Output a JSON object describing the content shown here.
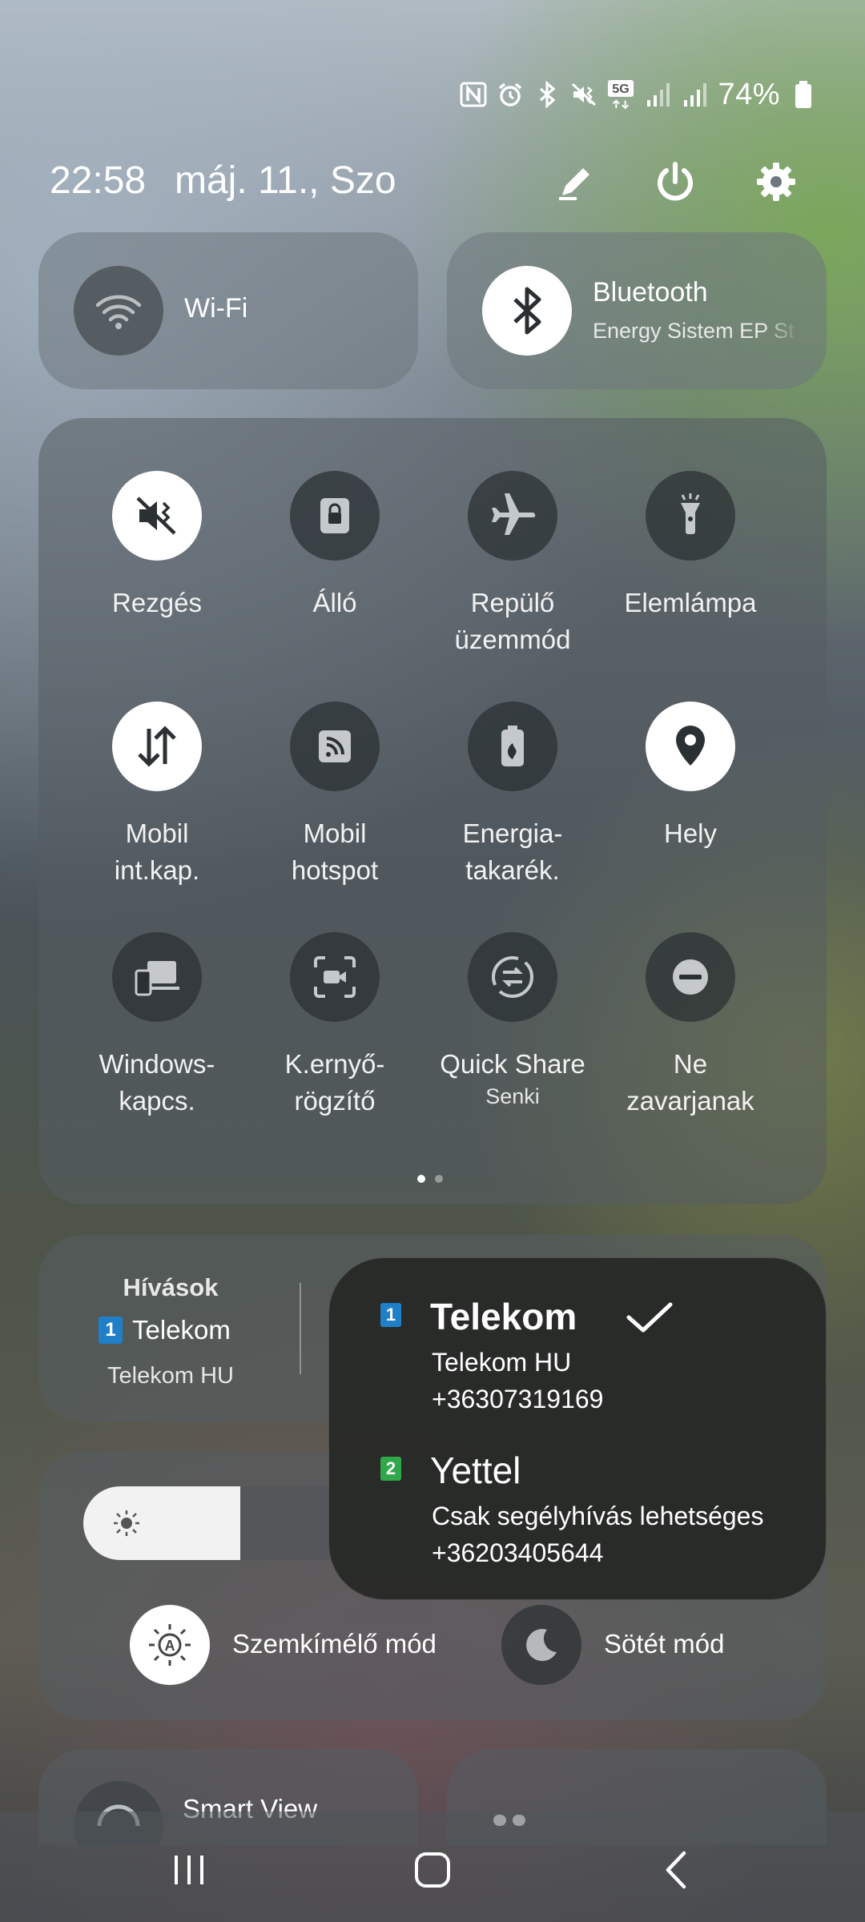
{
  "status_bar": {
    "icons": [
      "nfc-icon",
      "alarm-icon",
      "bluetooth-icon",
      "vibrate-icon",
      "5g-icon",
      "signal-sim1-icon",
      "signal-sim2-icon"
    ],
    "battery_text": "74%",
    "battery_level": 0.74
  },
  "header": {
    "time": "22:58",
    "date": "máj. 11., Szo",
    "buttons": [
      "edit-icon",
      "power-icon",
      "settings-icon"
    ]
  },
  "wifi": {
    "label": "Wi-Fi"
  },
  "bluetooth": {
    "label": "Bluetooth",
    "device": "Energy Sistem EP St"
  },
  "tiles": [
    {
      "label_1": "Rezgés",
      "label_2": "",
      "icon": "vibrate-icon",
      "on": true
    },
    {
      "label_1": "Álló",
      "label_2": "",
      "icon": "rotation-lock-icon",
      "on": false
    },
    {
      "label_1": "Repülő",
      "label_2": "üzemmód",
      "icon": "airplane-icon",
      "on": false
    },
    {
      "label_1": "Elemlámpa",
      "label_2": "",
      "icon": "flashlight-icon",
      "on": false
    },
    {
      "label_1": "Mobil",
      "label_2": "int.kap.",
      "icon": "mobile-data-icon",
      "on": true
    },
    {
      "label_1": "Mobil",
      "label_2": "hotspot",
      "icon": "hotspot-icon",
      "on": false
    },
    {
      "label_1": "Energia-",
      "label_2": "takarék.",
      "icon": "power-saving-icon",
      "on": false
    },
    {
      "label_1": "Hely",
      "label_2": "",
      "icon": "location-icon",
      "on": true
    },
    {
      "label_1": "Windows-",
      "label_2": "kapcs.",
      "icon": "link-to-windows-icon",
      "on": false
    },
    {
      "label_1": "K.ernyő-",
      "label_2": "rögzítő",
      "icon": "screen-recorder-icon",
      "on": false
    },
    {
      "label_1": "Quick Share",
      "label_2": "",
      "sub": "Senki",
      "icon": "quick-share-icon",
      "on": false
    },
    {
      "label_1": "Ne",
      "label_2": "zavarjanak",
      "icon": "do-not-disturb-icon",
      "on": false
    }
  ],
  "calls": {
    "title": "Hívások",
    "sim_number": "1",
    "carrier": "Telekom",
    "network": "Telekom HU"
  },
  "sim_popup": {
    "sims": [
      {
        "slot": "1",
        "name": "Telekom",
        "line1": "Telekom HU",
        "line2": "+36307319169",
        "selected": true,
        "color": "#1f7fc8"
      },
      {
        "slot": "2",
        "name": "Yettel",
        "line1": "Csak segélyhívás lehetséges",
        "line2": "+36203405644",
        "selected": false,
        "color": "#2fa84a"
      }
    ]
  },
  "brightness": {
    "eye_comfort_label": "Szemkímélő mód",
    "dark_mode_label": "Sötét mód"
  },
  "bottom": {
    "smart_view_label": "Smart View"
  },
  "colors": {
    "tile_on": "#ffffff",
    "tile_off": "#2b3033",
    "sim1": "#1f7fc8",
    "sim2": "#2fa84a"
  }
}
